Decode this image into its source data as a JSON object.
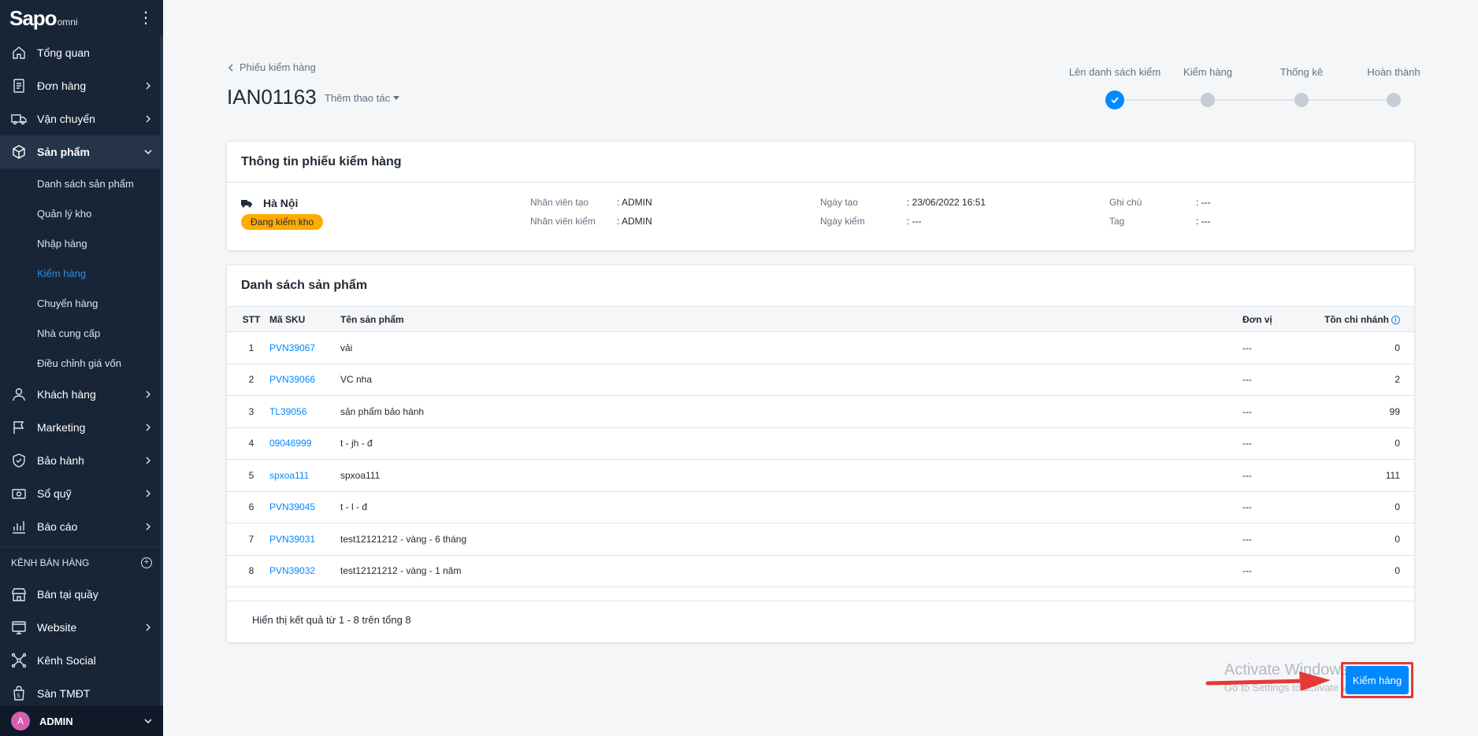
{
  "sidebar": {
    "logo_text": "Sapo",
    "logo_sub": "omni",
    "items": [
      {
        "label": "Tổng quan",
        "icon": "home-icon",
        "has_chevron": false
      },
      {
        "label": "Đơn hàng",
        "icon": "order-icon",
        "has_chevron": true
      },
      {
        "label": "Vận chuyển",
        "icon": "truck-icon",
        "has_chevron": true
      },
      {
        "label": "Sản phẩm",
        "icon": "box-icon",
        "has_chevron": true,
        "expanded": true
      }
    ],
    "sub_items": [
      {
        "label": "Danh sách sản phẩm",
        "active": false
      },
      {
        "label": "Quản lý kho",
        "active": false
      },
      {
        "label": "Nhập hàng",
        "active": false
      },
      {
        "label": "Kiểm hàng",
        "active": true
      },
      {
        "label": "Chuyển hàng",
        "active": false
      },
      {
        "label": "Nhà cung cấp",
        "active": false
      },
      {
        "label": "Điều chỉnh giá vốn",
        "active": false
      }
    ],
    "items2": [
      {
        "label": "Khách hàng",
        "icon": "user-icon"
      },
      {
        "label": "Marketing",
        "icon": "flag-icon"
      },
      {
        "label": "Bảo hành",
        "icon": "shield-icon"
      },
      {
        "label": "Sổ quỹ",
        "icon": "cash-icon"
      },
      {
        "label": "Báo cáo",
        "icon": "chart-icon"
      }
    ],
    "channels_label": "KÊNH BÁN HÀNG",
    "channels": [
      {
        "label": "Bán tại quầy",
        "icon": "store-icon",
        "has_chevron": false
      },
      {
        "label": "Website",
        "icon": "website-icon",
        "has_chevron": true
      },
      {
        "label": "Kênh Social",
        "icon": "social-icon",
        "has_chevron": false
      },
      {
        "label": "Sàn TMĐT",
        "icon": "marketplace-icon",
        "has_chevron": false
      }
    ],
    "user": {
      "initial": "A",
      "name": "ADMIN"
    }
  },
  "header": {
    "back_label": "Phiếu kiểm hàng",
    "title": "IAN01163",
    "more_actions": "Thêm thao tác"
  },
  "stepper": {
    "steps": [
      "Lên danh sách kiểm",
      "Kiểm hàng",
      "Thống kê",
      "Hoàn thành"
    ],
    "current": 0
  },
  "info": {
    "title": "Thông tin phiếu kiểm hàng",
    "location": "Hà Nội",
    "status": "Đang kiểm kho",
    "created_by_label": "Nhân viên tạo",
    "created_by": ": ADMIN",
    "checked_by_label": "Nhân viên kiểm",
    "checked_by": ": ADMIN",
    "created_date_label": "Ngày tạo",
    "created_date": ": 23/06/2022 16:51",
    "check_date_label": "Ngày kiểm",
    "check_date": ": ---",
    "note_label": "Ghi chú",
    "note": ": ---",
    "tag_label": "Tag",
    "tag": ": ---"
  },
  "products": {
    "title": "Danh sách sản phẩm",
    "columns": {
      "stt": "STT",
      "sku": "Mã SKU",
      "name": "Tên sản phẩm",
      "unit": "Đơn vị",
      "stock": "Tồn chi nhánh"
    },
    "rows": [
      {
        "stt": "1",
        "sku": "PVN39067",
        "name": "vải",
        "unit": "---",
        "stock": "0"
      },
      {
        "stt": "2",
        "sku": "PVN39066",
        "name": "VC nha",
        "unit": "---",
        "stock": "2"
      },
      {
        "stt": "3",
        "sku": "TL39056",
        "name": "sản phẩm bảo hành",
        "unit": "---",
        "stock": "99"
      },
      {
        "stt": "4",
        "sku": "09046999",
        "name": "t - jh - đ",
        "unit": "---",
        "stock": "0"
      },
      {
        "stt": "5",
        "sku": "spxoa111",
        "name": "spxoa111",
        "unit": "---",
        "stock": "111"
      },
      {
        "stt": "6",
        "sku": "PVN39045",
        "name": "t - l - đ",
        "unit": "---",
        "stock": "0"
      },
      {
        "stt": "7",
        "sku": "PVN39031",
        "name": "test12121212 - vàng - 6 tháng",
        "unit": "---",
        "stock": "0"
      },
      {
        "stt": "8",
        "sku": "PVN39032",
        "name": "test12121212 - vàng - 1 năm",
        "unit": "---",
        "stock": "0"
      }
    ],
    "footer": "Hiển thị kết quả từ 1 - 8 trên tổng 8"
  },
  "action": {
    "primary_label": "Kiểm hàng"
  },
  "watermark": {
    "line1": "Activate Windows",
    "line2": "Go to Settings to activate Windows."
  },
  "colors": {
    "sidebar_bg": "#182537",
    "accent": "#0088ff",
    "badge": "#ffab00",
    "highlight": "#e53935"
  }
}
